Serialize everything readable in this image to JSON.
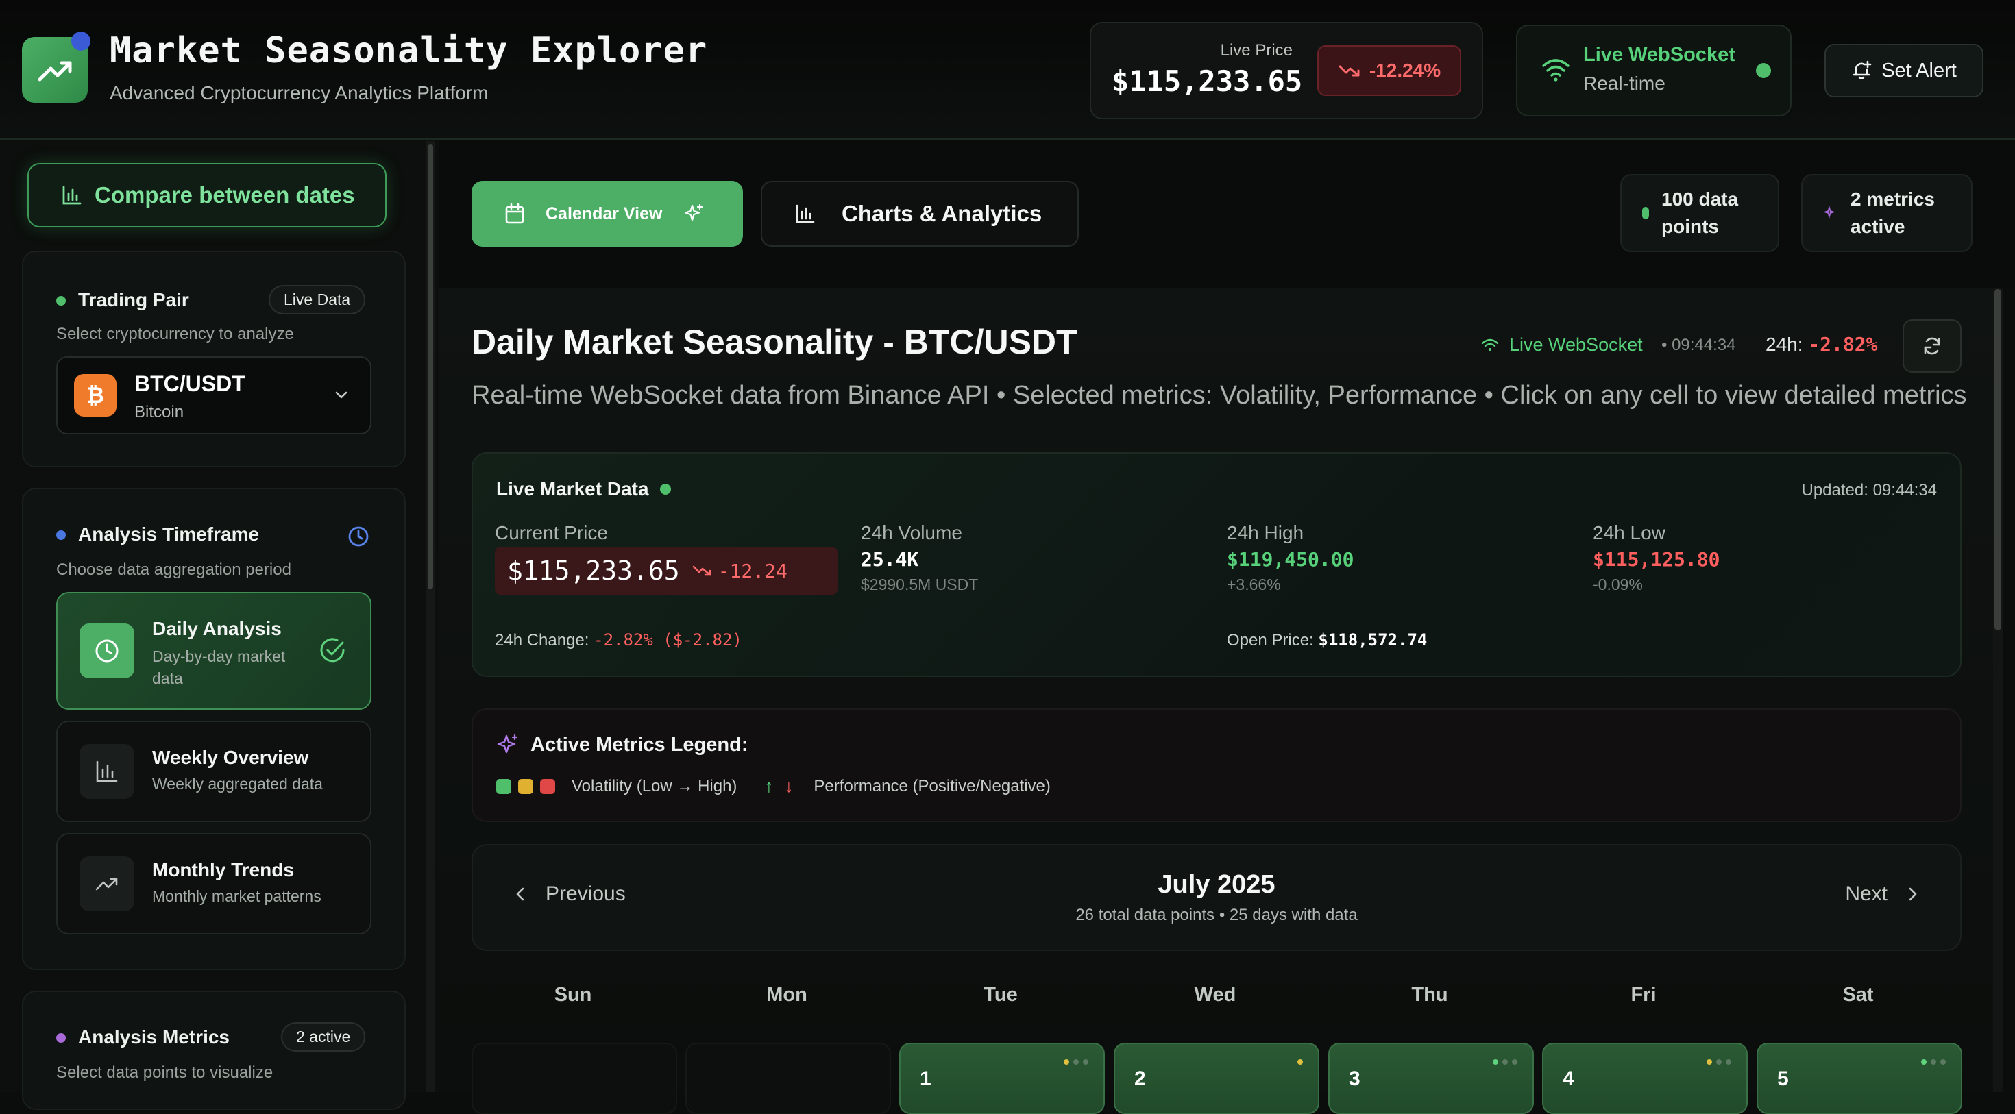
{
  "app": {
    "title": "Market Seasonality Explorer",
    "subtitle": "Advanced Cryptocurrency Analytics Platform"
  },
  "header": {
    "live_price_label": "Live Price",
    "live_price_value": "$115,233.65",
    "price_change": "-12.24%",
    "ws_title": "Live WebSocket",
    "ws_sub": "Real-time",
    "set_alert": "Set Alert"
  },
  "sidebar": {
    "compare_button": "Compare between dates",
    "trading_pair": {
      "title": "Trading Pair",
      "badge": "Live Data",
      "subtitle": "Select cryptocurrency to analyze",
      "symbol": "BTC/USDT",
      "name": "Bitcoin",
      "icon_glyph": "₿"
    },
    "timeframe": {
      "title": "Analysis Timeframe",
      "subtitle": "Choose data aggregation period",
      "options": [
        {
          "title": "Daily Analysis",
          "desc1": "Day-by-day market",
          "desc2": "data",
          "active": true
        },
        {
          "title": "Weekly Overview",
          "desc1": "Weekly aggregated data",
          "desc2": "",
          "active": false
        },
        {
          "title": "Monthly Trends",
          "desc1": "Monthly market patterns",
          "desc2": "",
          "active": false
        }
      ]
    },
    "metrics": {
      "title": "Analysis Metrics",
      "badge": "2 active",
      "subtitle": "Select data points to visualize"
    }
  },
  "tabs": {
    "calendar": "Calendar View",
    "charts": "Charts & Analytics",
    "data_points_1": "100 data",
    "data_points_2": "points",
    "metrics_active_1": "2 metrics",
    "metrics_active_2": "active"
  },
  "main": {
    "title": "Daily Market Seasonality - BTC/USDT",
    "live_ws": "Live WebSocket",
    "live_time": "• 09:44:34",
    "change_label": "24h:",
    "change_value": "-2.82%",
    "description": "Real-time WebSocket data from Binance API • Selected metrics: Volatility, Performance • Click on any cell to view detailed metrics"
  },
  "live_market": {
    "title": "Live Market Data",
    "updated": "Updated: 09:44:34",
    "current_price_label": "Current Price",
    "current_price": "$115,233.65",
    "current_change": "-12.24",
    "volume_label": "24h Volume",
    "volume": "25.4K",
    "volume_usdt": "$2990.5M USDT",
    "high_label": "24h High",
    "high": "$119,450.00",
    "high_pct": "+3.66%",
    "low_label": "24h Low",
    "low": "$115,125.80",
    "low_pct": "-0.09%",
    "change_label": "24h Change:",
    "change_value": "-2.82% ($-2.82)",
    "open_label": "Open Price:",
    "open_value": "$118,572.74"
  },
  "legend": {
    "title": "Active Metrics Legend:",
    "volatility": "Volatility (Low → High)",
    "performance": "Performance (Positive/Negative)"
  },
  "calendar": {
    "prev": "Previous",
    "next": "Next",
    "month": "July 2025",
    "summary": "26 total data points • 25 days with data",
    "weekdays": [
      "Sun",
      "Mon",
      "Tue",
      "Wed",
      "Thu",
      "Fri",
      "Sat"
    ],
    "days": [
      "1",
      "2",
      "3",
      "4",
      "5"
    ]
  },
  "colors": {
    "accent_green": "#4caf65",
    "negative_red": "#ff5f5f",
    "positive_green": "#57d27a"
  }
}
